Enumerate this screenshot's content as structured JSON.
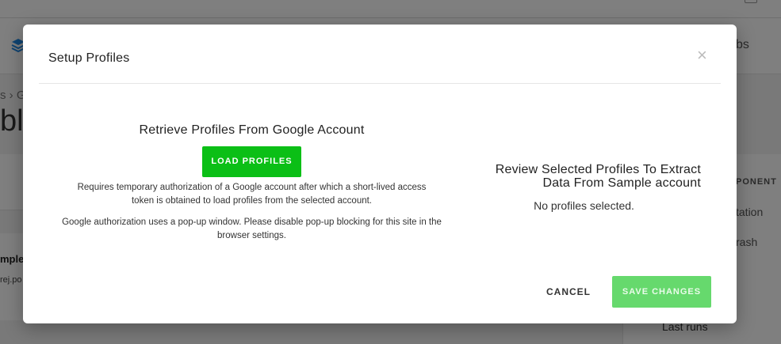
{
  "background": {
    "breadcrumb": "s  ›  G",
    "title": "ble",
    "tab": "bs",
    "row_title": "mple",
    "row_sub": "rej.po",
    "side_head": "PONENT",
    "side_item1": "tation",
    "side_item2": "rash",
    "side_last": "Last runs"
  },
  "modal": {
    "title": "Setup Profiles",
    "close_icon": "×",
    "left": {
      "heading": "Retrieve Profiles From Google Account",
      "load_button": "LOAD PROFILES",
      "desc1": "Requires temporary authorization of a Google account after which a short-lived access token is obtained to load profiles from the selected account.",
      "desc2": "Google authorization uses a pop-up window. Please disable pop-up blocking for this site in the browser settings."
    },
    "right": {
      "heading_line1": "Review Selected Profiles To Extract",
      "heading_line2": "Data From Sample account",
      "empty": "No profiles selected."
    },
    "cancel_button": "CANCEL",
    "save_button": "SAVE CHANGES"
  },
  "colors": {
    "primary_green": "#0bbf16",
    "disabled_green": "#66d96d",
    "overlay": "rgba(0,0,0,0.5)"
  }
}
